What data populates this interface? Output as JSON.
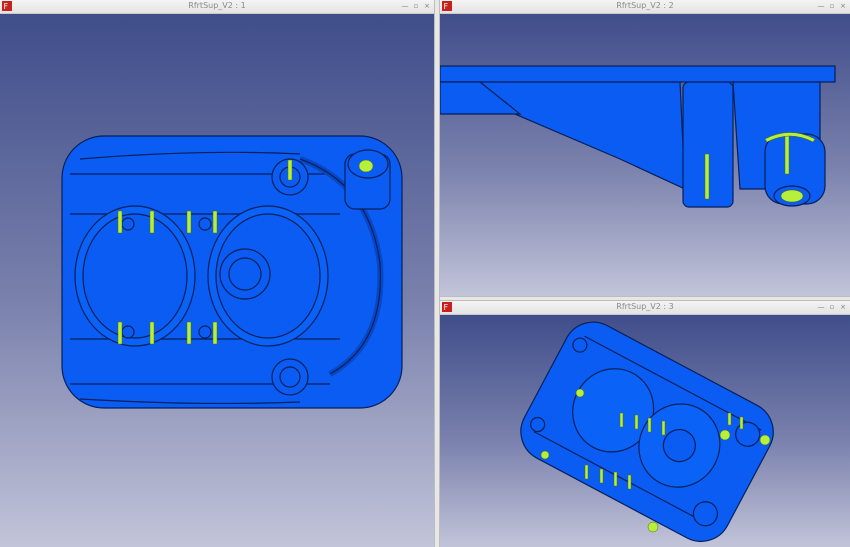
{
  "views": [
    {
      "title": "RfrtSup_V2 : 1"
    },
    {
      "title": "RfrtSup_V2 : 2"
    },
    {
      "title": "RfrtSup_V2 : 3"
    }
  ],
  "window_controls": {
    "minimize": "—",
    "maximize": "▫",
    "close": "×"
  },
  "colors": {
    "part": "#0a5cf2",
    "edge": "#06205a",
    "highlight": "#b6f03a",
    "background_top": "#3f4d8a",
    "background_bottom": "#c2c4d9"
  },
  "icons": {
    "app": "freecad-icon"
  }
}
